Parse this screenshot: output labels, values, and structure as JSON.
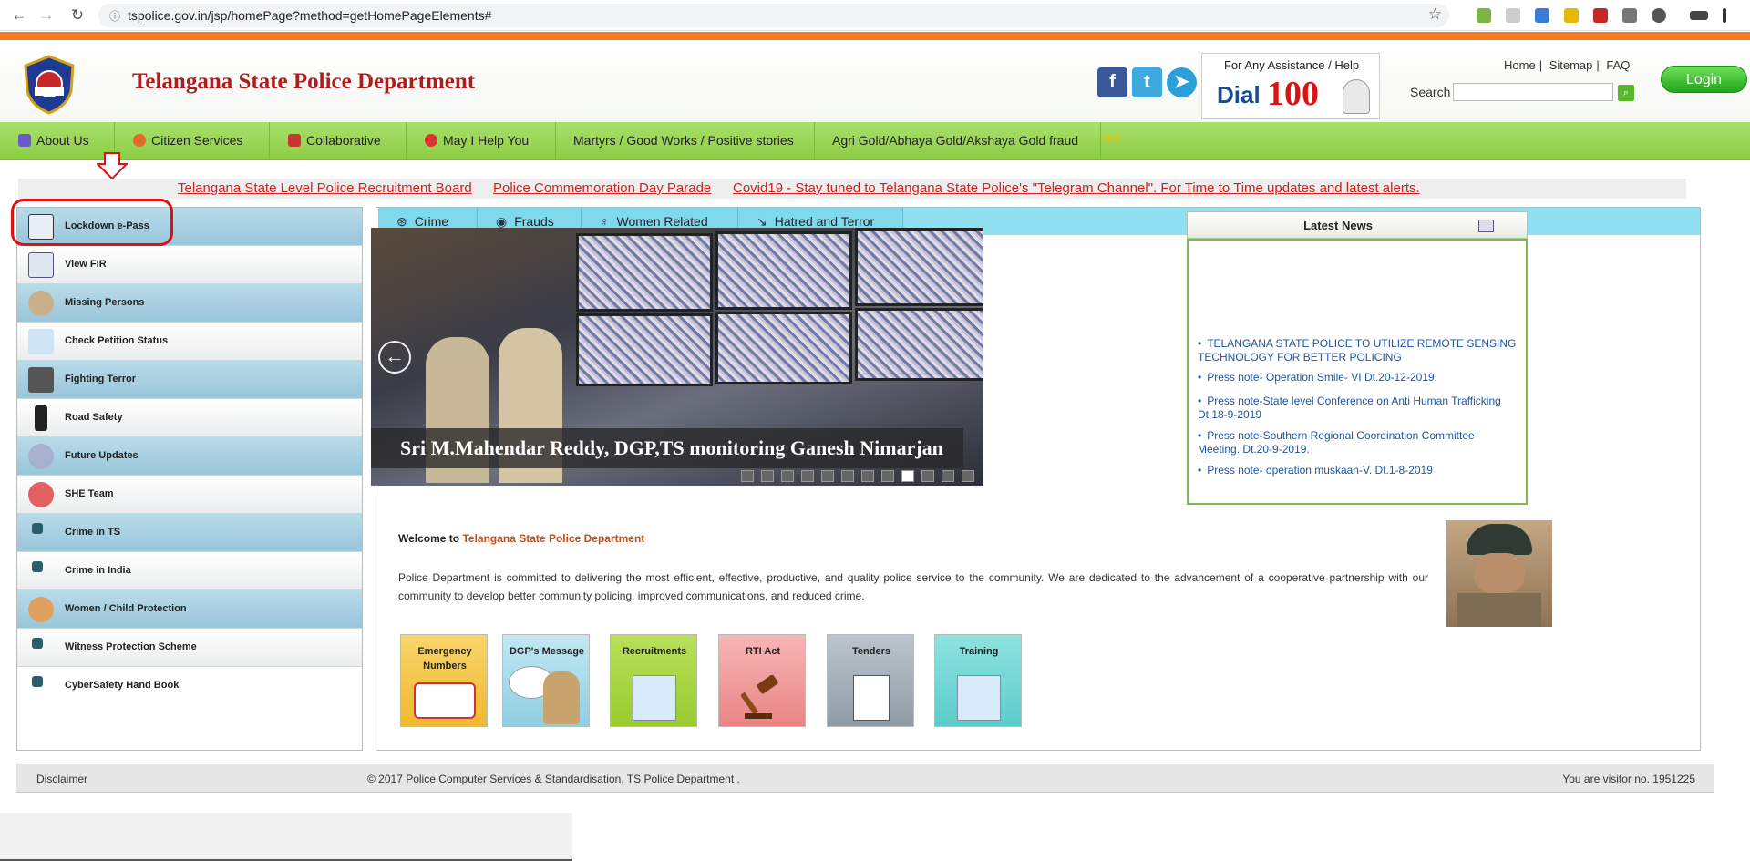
{
  "browser": {
    "url": "tspolice.gov.in/jsp/homePage?method=getHomePageElements#",
    "back_icon": "arrow-left-icon",
    "forward_icon": "arrow-right-icon",
    "reload_icon": "reload-icon"
  },
  "header": {
    "title": "Telangana State Police Department",
    "logo_text": "TELANGANA STATE POLICE",
    "help_title": "For Any Assistance / Help",
    "dial_label": "Dial",
    "dial_number": "100",
    "links": [
      "Home",
      "Sitemap",
      "FAQ"
    ],
    "search_label": "Search",
    "search_placeholder": "",
    "login_label": "Login",
    "social": [
      {
        "name": "facebook",
        "glyph": "f",
        "color": "#3b5998"
      },
      {
        "name": "twitter",
        "glyph": "t",
        "color": "#3fa9dd"
      },
      {
        "name": "telegram",
        "glyph": "➤",
        "color": "#2aa0da"
      }
    ]
  },
  "nav": {
    "items": [
      {
        "label": "About Us",
        "icon_color": "#6a5acd"
      },
      {
        "label": "Citizen Services",
        "icon_color": "#e06a2b"
      },
      {
        "label": "Collaborative",
        "icon_color": "#c33"
      },
      {
        "label": "May I Help You",
        "icon_color": "#d33"
      },
      {
        "label": "Martyrs / Good Works / Positive stories"
      },
      {
        "label": "Agri Gold/Abhaya Gold/Akshaya Gold fraud"
      }
    ],
    "new_badge": "NEW"
  },
  "marquee": {
    "items": [
      "Telangana State Level Police Recruitment Board",
      "Police Commemoration Day Parade",
      "Covid19 - Stay tuned to Telangana State Police's \"Telegram Channel\". For Time to Time updates and latest alerts."
    ]
  },
  "sidebar": {
    "items": [
      {
        "label": "Lockdown e-Pass",
        "icon_color": "#e8eef3"
      },
      {
        "label": "View FIR",
        "icon_color": "#dfe7f0"
      },
      {
        "label": "Missing Persons",
        "icon_color": "#c9b08b"
      },
      {
        "label": "Check Petition Status",
        "icon_color": "#d99a3a"
      },
      {
        "label": "Fighting Terror",
        "icon_color": "#333"
      },
      {
        "label": "Road Safety",
        "icon_color": "#222"
      },
      {
        "label": "Future Updates",
        "icon_color": "#88a"
      },
      {
        "label": "SHE Team",
        "icon_color": "#d44"
      },
      {
        "label": "Crime in TS",
        "icon_color": "#2a5f6a"
      },
      {
        "label": "Crime in India",
        "icon_color": "#2a5f6a"
      },
      {
        "label": "Women / Child Protection",
        "icon_color": "#e07a2b"
      },
      {
        "label": "Witness Protection Scheme",
        "icon_color": "#2a5f6a"
      },
      {
        "label": "CyberSafety Hand Book",
        "icon_color": "#2a5f6a"
      }
    ]
  },
  "tabs": [
    {
      "label": "Crime",
      "icon": "fingerprint-icon"
    },
    {
      "label": "Frauds",
      "icon": "thief-icon"
    },
    {
      "label": "Women Related",
      "icon": "woman-icon"
    },
    {
      "label": "Hatred and Terror",
      "icon": "arrow-icon"
    }
  ],
  "slider": {
    "caption": "Sri M.Mahendar Reddy, DGP,TS monitoring Ganesh Nimarjan",
    "prev_glyph": "←",
    "dot_count": 12,
    "active_dot": 8
  },
  "news": {
    "title": "Latest News",
    "items": [
      "TELANGANA STATE POLICE TO UTILIZE REMOTE SENSING TECHNOLOGY FOR BETTER POLICING",
      "Press note- Operation Smile- VI Dt.20-12-2019.",
      "Press note-State level Conference on Anti Human Trafficking Dt.18-9-2019",
      "Press note-Southern Regional Coordination Committee Meeting. Dt.20-9-2019.",
      "Press note- operation muskaan-V. Dt.1-8-2019"
    ]
  },
  "welcome": {
    "prefix": "Welcome to",
    "brand": "Telangana State Police Department",
    "text": "Police Department is committed to delivering the most efficient, effective, productive, and quality police service to the community. We are dedicated to the advancement of a cooperative partnership with our community to develop better community policing, improved communications, and reduced crime."
  },
  "tiles": [
    {
      "label": "Emergency Numbers",
      "color": "#f5c84a",
      "icon": "ambulance-icon"
    },
    {
      "label": "DGP's Message",
      "color": "#a9dbe8",
      "icon": "officer-icon"
    },
    {
      "label": "Recruitments",
      "color": "#a6d64a",
      "icon": "certificate-icon"
    },
    {
      "label": "RTI Act",
      "color": "#f0a0a0",
      "icon": "gavel-icon"
    },
    {
      "label": "Tenders",
      "color": "#a8b3bd",
      "icon": "document-icon"
    },
    {
      "label": "Training",
      "color": "#6fd8d4",
      "icon": "certificate-icon"
    }
  ],
  "footer": {
    "disclaimer": "Disclaimer",
    "copyright": "© 2017 Police Computer Services & Standardisation, TS Police Department .",
    "visitor": "You are visitor no. 1951225"
  }
}
